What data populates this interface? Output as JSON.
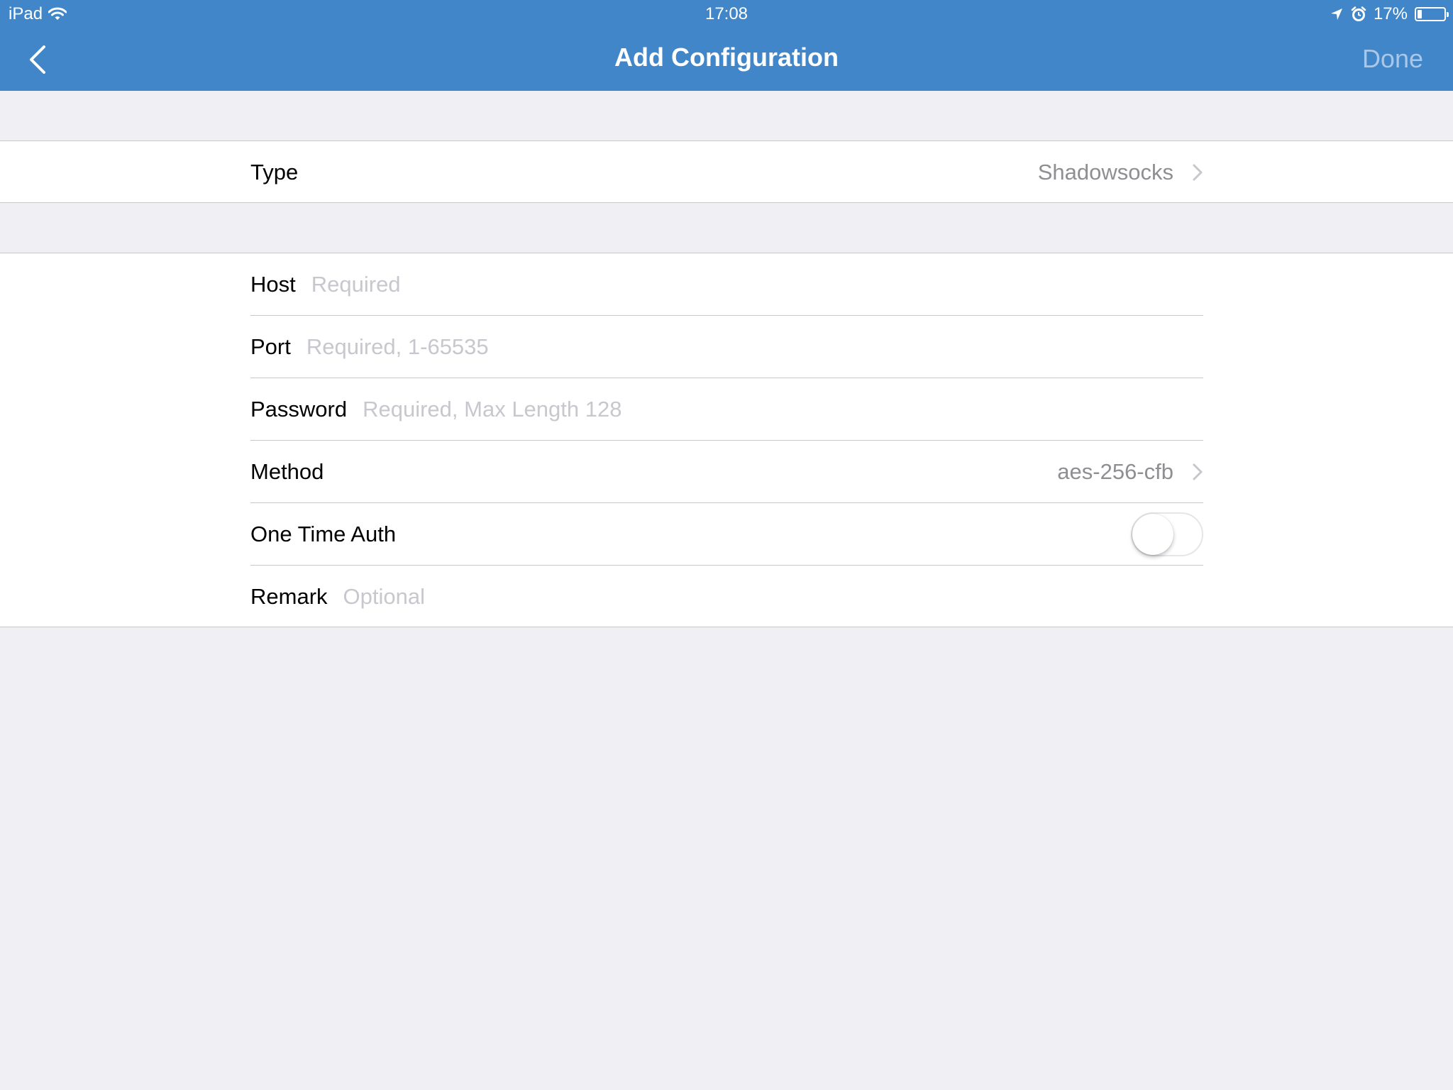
{
  "status_bar": {
    "device": "iPad",
    "time": "17:08",
    "battery_text": "17%",
    "battery_level": 0.17,
    "icons": [
      "wifi-icon",
      "location-arrow-icon",
      "alarm-icon",
      "battery-icon"
    ]
  },
  "nav": {
    "title": "Add Configuration",
    "back_icon": "chevron-left-icon",
    "done_label": "Done",
    "done_color": "#a9c8e8"
  },
  "colors": {
    "header_bg": "#4186c8",
    "page_bg": "#efeff4",
    "detail_text": "#8e8e93",
    "placeholder": "#c7c7cd"
  },
  "type_row": {
    "label": "Type",
    "value": "Shadowsocks"
  },
  "fields": {
    "host": {
      "label": "Host",
      "placeholder": "Required",
      "value": ""
    },
    "port": {
      "label": "Port",
      "placeholder": "Required, 1-65535",
      "value": ""
    },
    "password": {
      "label": "Password",
      "placeholder": "Required, Max Length 128",
      "value": ""
    },
    "method": {
      "label": "Method",
      "value": "aes-256-cfb"
    },
    "one_time_auth": {
      "label": "One Time Auth",
      "enabled": false
    },
    "remark": {
      "label": "Remark",
      "placeholder": "Optional",
      "value": ""
    }
  }
}
